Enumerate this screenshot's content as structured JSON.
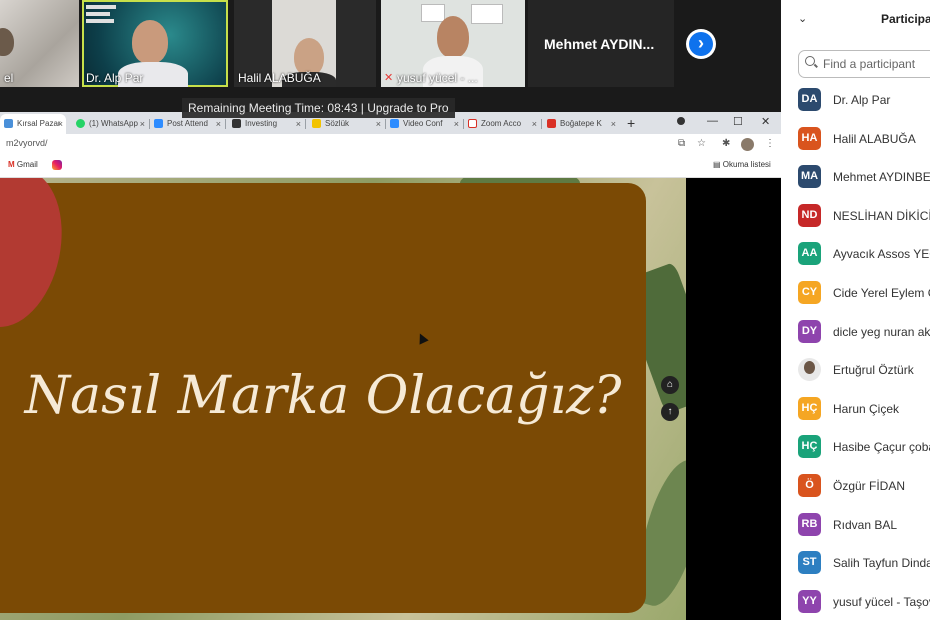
{
  "meeting": {
    "timer_text": "Remaining Meeting Time: 08:43 | Upgrade to Pro",
    "tiles": [
      {
        "name": "el"
      },
      {
        "name": "Dr. Alp Par"
      },
      {
        "name": "Halil ALABUĞA"
      },
      {
        "name": "yusuf yücel - ..."
      },
      {
        "name": "Mehmet  AYDIN..."
      }
    ],
    "next_icon": "›"
  },
  "browser": {
    "tabs": [
      {
        "label": "Kırsal Pazar",
        "color": "#4a90d9",
        "active": true
      },
      {
        "label": "(1) WhatsApp",
        "color": "#25d366"
      },
      {
        "label": "Post Attend",
        "color": "#2d8cff"
      },
      {
        "label": "Investing",
        "color": "#333333"
      },
      {
        "label": "Sözlük",
        "color": "#f2c300"
      },
      {
        "label": "Video Conf",
        "color": "#2d8cff"
      },
      {
        "label": "Zoom Acco",
        "color": "#2d8cff"
      },
      {
        "label": "Boğatepe K",
        "color": "#d93025"
      }
    ],
    "tab_close": "×",
    "new_tab": "+",
    "window_controls": [
      "—",
      "☐",
      "✕"
    ],
    "url": "m2vyorvd/",
    "bookmarks": [
      {
        "label": "Gmail",
        "icon": "gmail-icon"
      },
      {
        "label": "",
        "icon": "instagram-icon"
      }
    ],
    "reading_list": "Okuma listesi"
  },
  "slide": {
    "title": "Nasıl Marka Olacağız?",
    "home_icon": "⌂",
    "up_icon": "↑"
  },
  "participants": {
    "title": "Participa",
    "collapse_icon": "⌄",
    "search_placeholder": "Find a participant",
    "list": [
      {
        "initials": "DA",
        "name": "Dr. Alp Par",
        "color": "#2c4a6e"
      },
      {
        "initials": "HA",
        "name": "Halil ALABUĞA",
        "color": "#d9541e"
      },
      {
        "initials": "MA",
        "name": "Mehmet  AYDINBEL",
        "color": "#2c4a6e"
      },
      {
        "initials": "ND",
        "name": "NESLİHAN DİKİCİ/F",
        "color": "#c62828"
      },
      {
        "initials": "AA",
        "name": "Ayvacık Assos YEG",
        "color": "#1aa37a"
      },
      {
        "initials": "CY",
        "name": "Cide Yerel Eylem G",
        "color": "#f5a623"
      },
      {
        "initials": "DY",
        "name": "dicle yeg nuran ak",
        "color": "#8e44ad"
      },
      {
        "initials": "",
        "name": "Ertuğrul Öztürk",
        "color": "#e8e8e8"
      },
      {
        "initials": "HÇ",
        "name": "Harun Çiçek",
        "color": "#f5a623"
      },
      {
        "initials": "HÇ",
        "name": "Hasibe Çaçur çoba",
        "color": "#1aa37a"
      },
      {
        "initials": "Ö",
        "name": "Özgür FİDAN",
        "color": "#d9541e"
      },
      {
        "initials": "RB",
        "name": "Rıdvan BAL",
        "color": "#8e44ad"
      },
      {
        "initials": "ST",
        "name": "Salih Tayfun Dinda",
        "color": "#2d7fc1"
      },
      {
        "initials": "YY",
        "name": "yusuf yücel - Taşov",
        "color": "#8e44ad"
      }
    ]
  }
}
